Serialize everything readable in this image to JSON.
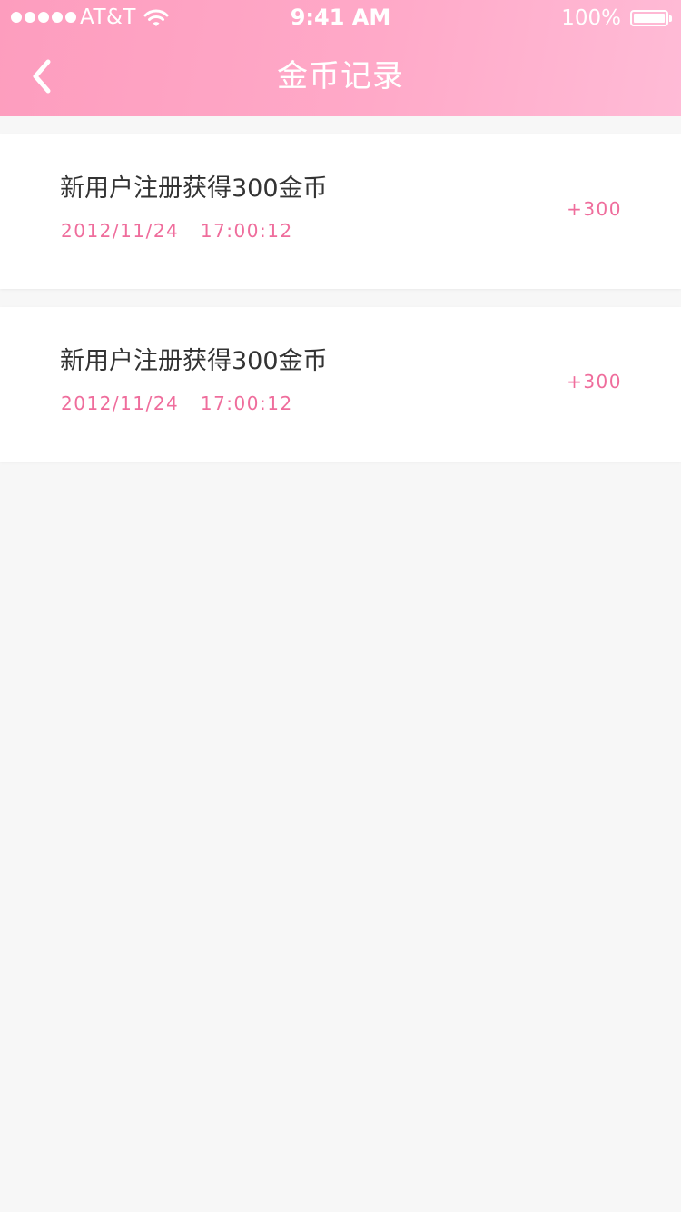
{
  "status_bar": {
    "carrier": "AT&T",
    "time": "9:41 AM",
    "battery": "100%",
    "battery_level": 1.0,
    "icons": [
      "signal-dots-icon",
      "wifi-icon",
      "battery-icon"
    ]
  },
  "header": {
    "back_icon": "chevron-left-icon",
    "title": "金币记录",
    "gradient_colors": [
      "#fd9dbe",
      "#ffbbd6"
    ]
  },
  "records": [
    {
      "title": "新用户注册获得300金币",
      "datetime": "2012/11/24   17:00:12",
      "amount": "+300"
    },
    {
      "title": "新用户注册获得300金币",
      "datetime": "2012/11/24   17:00:12",
      "amount": "+300"
    }
  ],
  "colors": {
    "accent": "#ef6d9c",
    "title_text": "#333333",
    "background": "#f7f7f7",
    "card": "#ffffff"
  }
}
